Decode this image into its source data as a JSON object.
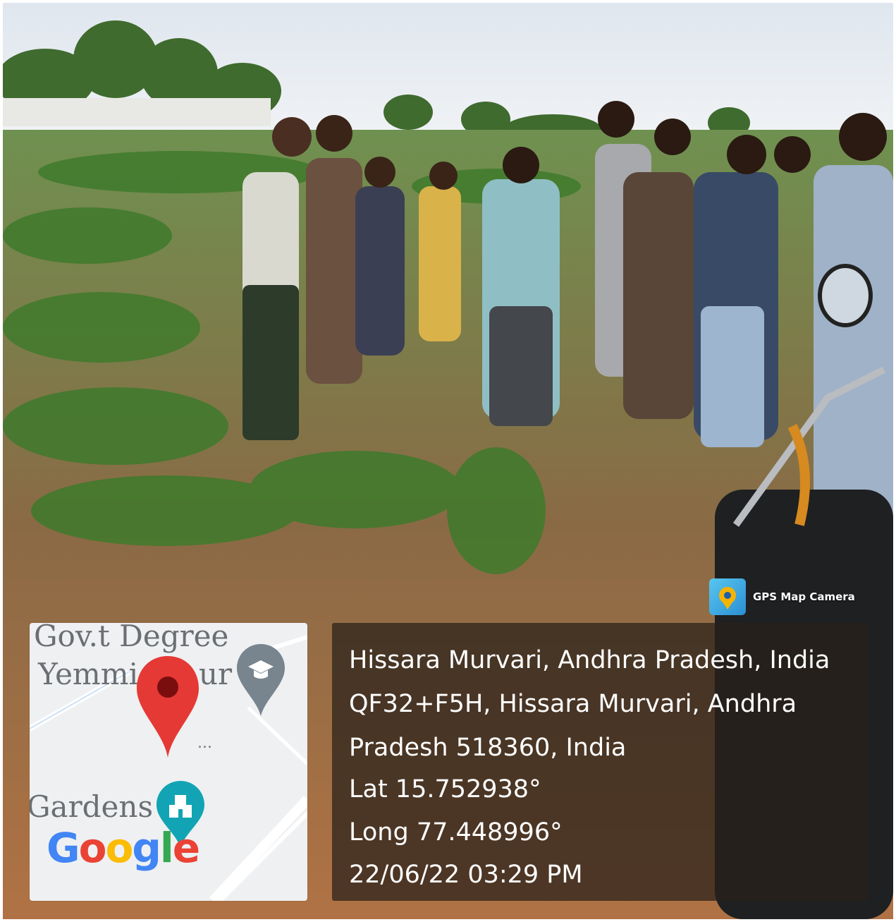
{
  "overlay": {
    "camera_label": "GPS Map Camera",
    "camera_icon": "gps-map-camera-icon",
    "place_title": "Hissara Murvari, Andhra Pradesh, India",
    "address_line1": "QF32+F5H, Hissara Murvari, Andhra",
    "address_line2": "Pradesh 518360, India",
    "latitude": "Lat 15.752938°",
    "longitude": "Long 77.448996°",
    "datetime": "22/06/22 03:29 PM"
  },
  "map": {
    "label_top": "Gov.t Degree",
    "label_mid_left": "Yemmi",
    "label_mid_right": "ur",
    "label_bottom": "Gardens",
    "logo_letters": [
      "G",
      "o",
      "o",
      "g",
      "l",
      "e"
    ],
    "pin_icon": "map-pin-icon",
    "school_icon": "school-icon",
    "landmark_icon": "landmark-icon",
    "ellipsis": "...",
    "accent_red": "#e53935",
    "pin_grey": "#78848e",
    "pin_teal": "#12a4b4"
  },
  "scene": {
    "description_colors": {
      "sky": "#e6ecf2",
      "field_green": "#4f7a34",
      "soil": "#a8693e"
    }
  }
}
